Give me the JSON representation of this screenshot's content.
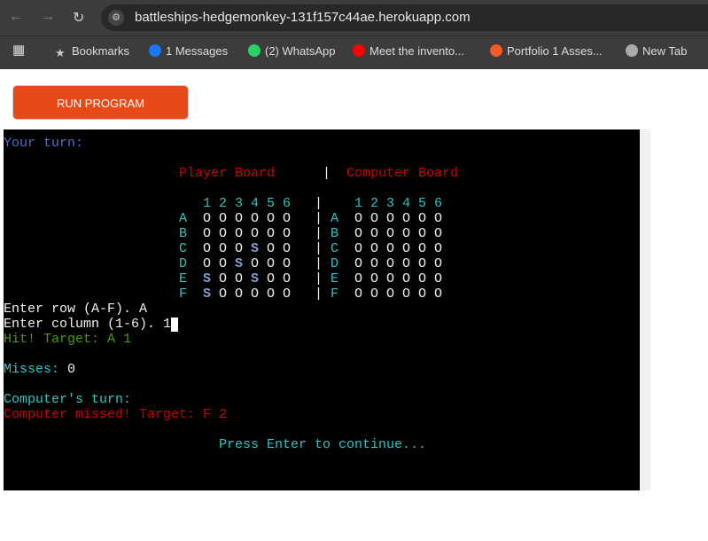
{
  "browser": {
    "url": "battleships-hedgemonkey-131f157c44ae.herokuapp.com",
    "bookmarks": [
      {
        "label": "Bookmarks",
        "icon": "star-icon"
      },
      {
        "label": "1 Messages",
        "icon": "facebook-icon"
      },
      {
        "label": "(2) WhatsApp",
        "icon": "whatsapp-icon"
      },
      {
        "label": "Meet the invento...",
        "icon": "youtube-icon"
      },
      {
        "label": "Portfolio 1 Asses...",
        "icon": "portfolio-icon"
      },
      {
        "label": "New Tab",
        "icon": "globe-icon"
      }
    ]
  },
  "run_button": "RUN PROGRAM",
  "terminal": {
    "your_turn": "Your turn:",
    "player_board_title": "Player Board",
    "computer_board_title": "Computer Board",
    "columns": [
      "1",
      "2",
      "3",
      "4",
      "5",
      "6"
    ],
    "rows": [
      "A",
      "B",
      "C",
      "D",
      "E",
      "F"
    ],
    "player_board": [
      [
        "O",
        "O",
        "O",
        "O",
        "O",
        "O"
      ],
      [
        "O",
        "O",
        "O",
        "O",
        "O",
        "O"
      ],
      [
        "O",
        "O",
        "O",
        "S",
        "O",
        "O"
      ],
      [
        "O",
        "O",
        "S",
        "O",
        "O",
        "O"
      ],
      [
        "S",
        "O",
        "O",
        "S",
        "O",
        "O"
      ],
      [
        "S",
        "O",
        "O",
        "O",
        "O",
        "O"
      ]
    ],
    "computer_board": [
      [
        "O",
        "O",
        "O",
        "O",
        "O",
        "O"
      ],
      [
        "O",
        "O",
        "O",
        "O",
        "O",
        "O"
      ],
      [
        "O",
        "O",
        "O",
        "O",
        "O",
        "O"
      ],
      [
        "O",
        "O",
        "O",
        "O",
        "O",
        "O"
      ],
      [
        "O",
        "O",
        "O",
        "O",
        "O",
        "O"
      ],
      [
        "O",
        "O",
        "O",
        "O",
        "O",
        "O"
      ]
    ],
    "enter_row": "Enter row (A-F). A",
    "enter_col": "Enter column (1-6). 1",
    "hit": "Hit! Target: A 1",
    "misses_label": "Misses:",
    "misses_value": "0",
    "computer_turn": "Computer's turn:",
    "computer_missed": "Computer missed! Target: F 2",
    "press_enter": "Press Enter to continue..."
  },
  "colors": {
    "run_button": "#e84a17",
    "terminal_bg": "#000000",
    "title_red": "#cc0000",
    "label_cyan": "#2ec4c4",
    "ship": "#7fa0cc",
    "hit_green": "#4e9a06",
    "prompt_blue": "#4d6fc4"
  }
}
